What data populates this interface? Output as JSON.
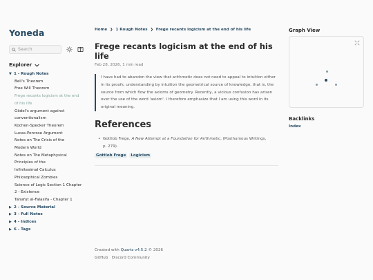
{
  "site": {
    "title": "Yoneda"
  },
  "search": {
    "placeholder": "Search"
  },
  "explorer": {
    "label": "Explorer",
    "tree": [
      {
        "type": "folder",
        "label": "1 - Rough Notes",
        "open": true
      },
      {
        "type": "file",
        "label": "Bell's Theorem"
      },
      {
        "type": "file",
        "label": "Free Will Theorem"
      },
      {
        "type": "file",
        "label": "Frege recants logicism at the end",
        "active": true
      },
      {
        "type": "file",
        "label": "of his life",
        "active": true
      },
      {
        "type": "file",
        "label": "Gödel's argument against"
      },
      {
        "type": "file",
        "label": "conventionalism"
      },
      {
        "type": "file",
        "label": "Kochen-Specker Theorem"
      },
      {
        "type": "file",
        "label": "Lucas-Penrose Argument"
      },
      {
        "type": "file",
        "label": "Notes on The Crisis of the"
      },
      {
        "type": "file",
        "label": "Modern World"
      },
      {
        "type": "file",
        "label": "Notes on The Metaphysical"
      },
      {
        "type": "file",
        "label": "Principles of the"
      },
      {
        "type": "file",
        "label": "Infinitesimal Calculus"
      },
      {
        "type": "file",
        "label": "Philosophical Zombies"
      },
      {
        "type": "file",
        "label": "Science of Logic Section 1 Chapter"
      },
      {
        "type": "file",
        "label": "2 - Existence"
      },
      {
        "type": "file",
        "label": "Tahafut al-Falasifa - Chapter 1"
      },
      {
        "type": "folder",
        "label": "2 - Source Material",
        "open": false
      },
      {
        "type": "folder",
        "label": "3 - Full Notes",
        "open": false
      },
      {
        "type": "folder",
        "label": "4 - Indices",
        "open": false
      },
      {
        "type": "folder",
        "label": "6 - Tags",
        "open": false
      }
    ]
  },
  "breadcrumbs": [
    "Home",
    "1 Rough Notes",
    "Frege recants logicism at the end of his life"
  ],
  "article": {
    "title": "Frege recants logicism at the end of his life",
    "date": "Feb 28, 2026",
    "read_time": "1 min read",
    "quote_lines": [
      "I have had to abandon the view that arithmetic does not need to appeal to intuition either",
      "in its proofs, understanding by intuition the geometrical source of knowledge, that is, the",
      "source from which flow the axioms of geometry. Recently, a vicious confusion has arisen",
      "over the use of the word 'axiom'. I therefore emphasize that I am using this word in its",
      "original meaning."
    ],
    "references_heading": "References",
    "reference": {
      "author": "Gottlob Frege, ",
      "title": "A New Attempt at a Foundation for Arithmetic",
      "rest": ", (Posthumous Writings,",
      "pages": "p. 279)."
    },
    "tags": [
      "Gottlob Frege",
      "Logicism"
    ]
  },
  "footer": {
    "created_prefix": "Created with ",
    "created_link": "Quartz v4.5.2",
    "created_suffix": " © 2026",
    "links": [
      "GitHub",
      "Discord Community"
    ]
  },
  "graph": {
    "title": "Graph View"
  },
  "backlinks": {
    "title": "Backlinks",
    "items": [
      "Index"
    ]
  }
}
